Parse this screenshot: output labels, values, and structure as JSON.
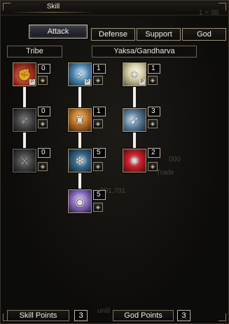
{
  "window": {
    "title": "Skill"
  },
  "tabs": [
    {
      "label": "Attack",
      "active": true
    },
    {
      "label": "Defense",
      "active": false
    },
    {
      "label": "Support",
      "active": false
    },
    {
      "label": "God",
      "active": false
    }
  ],
  "filters": {
    "category": "Tribe",
    "tribe": "Yaksa/Gandharva"
  },
  "skills": [
    {
      "row": 1,
      "col": 1,
      "level": "0",
      "icon": "flame-fist-icon",
      "passive": true,
      "unlocked": true
    },
    {
      "row": 1,
      "col": 2,
      "level": "1",
      "icon": "lightning-strike-icon",
      "passive": true,
      "unlocked": true
    },
    {
      "row": 1,
      "col": 3,
      "level": "1",
      "icon": "light-burst-icon",
      "passive": true,
      "unlocked": true
    },
    {
      "row": 2,
      "col": 1,
      "level": "0",
      "icon": "wind-slash-icon",
      "passive": false,
      "unlocked": false
    },
    {
      "row": 2,
      "col": 2,
      "level": "1",
      "icon": "warrior-aura-icon",
      "passive": false,
      "unlocked": true
    },
    {
      "row": 2,
      "col": 3,
      "level": "3",
      "icon": "dash-strike-icon",
      "passive": false,
      "unlocked": true
    },
    {
      "row": 3,
      "col": 1,
      "level": "0",
      "icon": "beast-claw-icon",
      "passive": false,
      "unlocked": false
    },
    {
      "row": 3,
      "col": 2,
      "level": "5",
      "icon": "ice-blade-icon",
      "passive": false,
      "unlocked": true
    },
    {
      "row": 3,
      "col": 3,
      "level": "2",
      "icon": "crimson-vortex-icon",
      "passive": false,
      "unlocked": true
    },
    {
      "row": 4,
      "col": 2,
      "level": "5",
      "icon": "spirit-orb-icon",
      "passive": false,
      "unlocked": true
    }
  ],
  "footer": {
    "skill_points_label": "Skill Points",
    "skill_points_value": "3",
    "god_points_label": "God Points",
    "god_points_value": "3"
  },
  "background_text": {
    "gold": "091,701",
    "trade": "Trade",
    "top_right": "1 = 98",
    "bottom": "until"
  }
}
